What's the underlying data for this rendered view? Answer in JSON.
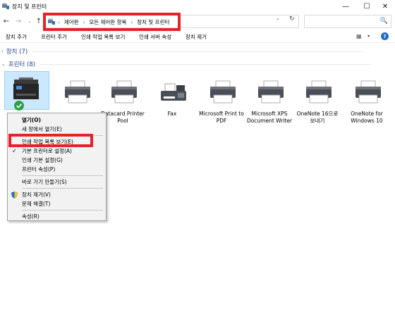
{
  "window": {
    "title": "장치 및 프린터",
    "minimize": "—",
    "maximize": "☐",
    "close": "✕"
  },
  "nav": {
    "back": "←",
    "forward": "→",
    "dropdown": "⌄",
    "up": "↑",
    "breadcrumbs": [
      "제어판",
      "모든 제어판 항목",
      "장치 및 프린터"
    ],
    "separator": "›",
    "address_dropdown": "⌄",
    "refresh": "↻",
    "search_value": "",
    "search_icon": "🔍"
  },
  "toolbar": {
    "items": [
      "장치 추가",
      "프린터 추가",
      "인쇄 작업 목록 보기",
      "인쇄 서버 속성",
      "장치 제거"
    ],
    "view_icon": "▦",
    "view_dropdown": "▾",
    "help": "?"
  },
  "groups": {
    "devices": {
      "chevron": "›",
      "label": "장치 (7)"
    },
    "printers": {
      "chevron": "⌄",
      "label": "프린터 (8)"
    }
  },
  "printers": [
    {
      "name": "",
      "icon": "multifunction-printer-icon",
      "selected": true,
      "default": true
    },
    {
      "name": "",
      "icon": "printer-icon"
    },
    {
      "name": "Datacard Printer Pool",
      "icon": "printer-icon"
    },
    {
      "name": "Fax",
      "icon": "fax-icon"
    },
    {
      "name": "Microsoft Print to PDF",
      "icon": "printer-icon"
    },
    {
      "name": "Microsoft XPS Document Writer",
      "icon": "printer-icon"
    },
    {
      "name": "OneNote 16으로 보내기",
      "icon": "printer-icon"
    },
    {
      "name": "OneNote for Windows 10",
      "icon": "printer-icon"
    }
  ],
  "context_menu": {
    "items": [
      {
        "label": "열기(O)",
        "bold": true
      },
      {
        "label": "새 창에서 열기(E)"
      },
      {
        "label": "인쇄 작업 목록 보기(E)"
      },
      {
        "label": "기본 프린터로 설정(A)",
        "checked": true,
        "check": "✓"
      },
      {
        "label": "인쇄 기본 설정(G)"
      },
      {
        "label": "프린터 속성(P)"
      },
      {
        "label": "바로 가기 만들기(S)"
      },
      {
        "label": "장치 제거(V)",
        "icon": "shield-icon"
      },
      {
        "label": "문제 해결(T)"
      },
      {
        "label": "속성(R)"
      }
    ]
  },
  "colors": {
    "highlight_box": "#e8202a",
    "selection_bg": "#cce8ff",
    "group_header": "#1e3d8f",
    "default_badge": "#2ea043"
  }
}
